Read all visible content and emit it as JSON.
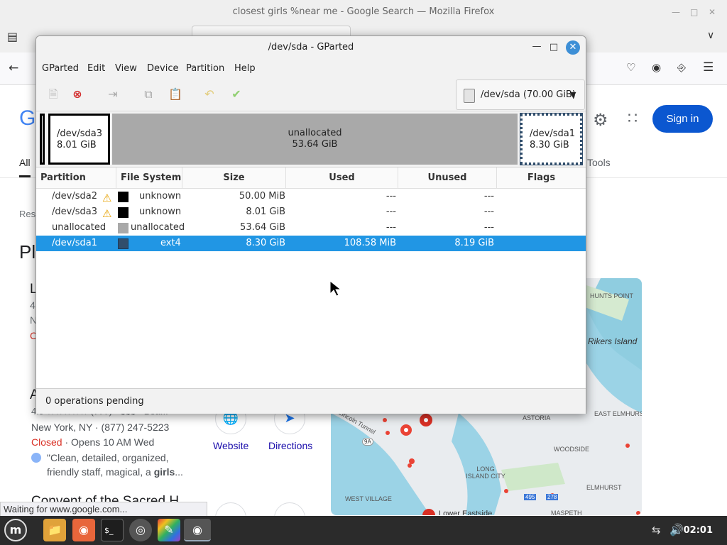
{
  "firefox": {
    "title": "closest girls %near me - Google Search — Mozilla Firefox",
    "status": "Waiting for www.google.com..."
  },
  "google": {
    "logo_fragment": "G",
    "tab_all": "All",
    "tools": "Tools",
    "results_fragment": "Res",
    "places_fragment": "Pl",
    "sign_in": "Sign in",
    "listing_fragments": {
      "l1": "L",
      "l2": "4",
      "l3": "N",
      "l4": "C",
      "l5": "A",
      "rating_fragment": "4.9 ★★★★★ (777) · $$$ · Bea..."
    },
    "listing": {
      "address": "New York, NY · (877) 247-5223",
      "closed": "Closed",
      "opens": " · Opens 10 AM Wed",
      "review_line1": "\"Clean, detailed, organized,",
      "review_line2_pre": "friendly staff, magical, a ",
      "review_line2_bold": "girls",
      "review_line2_post": "...",
      "website": "Website",
      "directions": "Directions",
      "next_title": "Convent of the Sacred H..."
    },
    "map_labels": [
      "HUNTS POINT",
      "Rikers Island",
      "EAST ELMHURST",
      "ASTORIA",
      "WOODSIDE",
      "LONG ISLAND CITY",
      "ELMHURST",
      "WEST VILLAGE",
      "MASPETH",
      "Lower Eastside",
      "Lincoln Tunnel",
      "9A",
      "495",
      "278"
    ]
  },
  "gparted": {
    "title": "/dev/sda - GParted",
    "menu": [
      "GParted",
      "Edit",
      "View",
      "Device",
      "Partition",
      "Help"
    ],
    "device": "/dev/sda (70.00 GiB)",
    "visual": [
      {
        "name": "/dev/sda3",
        "size": "8.01 GiB"
      },
      {
        "name": "unallocated",
        "size": "53.64 GiB"
      },
      {
        "name": "/dev/sda1",
        "size": "8.30 GiB"
      }
    ],
    "columns": [
      "Partition",
      "File System",
      "Size",
      "Used",
      "Unused",
      "Flags"
    ],
    "rows": [
      {
        "partition": "/dev/sda2",
        "fs": "unknown",
        "size": "50.00 MiB",
        "used": "---",
        "unused": "---",
        "warn": true
      },
      {
        "partition": "/dev/sda3",
        "fs": "unknown",
        "size": "8.01 GiB",
        "used": "---",
        "unused": "---",
        "warn": true
      },
      {
        "partition": "unallocated",
        "fs": "unallocated",
        "size": "53.64 GiB",
        "used": "---",
        "unused": "---",
        "warn": false
      },
      {
        "partition": "/dev/sda1",
        "fs": "ext4",
        "size": "8.30 GiB",
        "used": "108.58 MiB",
        "unused": "8.19 GiB",
        "warn": false
      }
    ],
    "status": "0 operations pending",
    "colors": {
      "selection": "#2196e4",
      "unknown_fs": "#000000",
      "unallocated_fs": "#a9a9a9",
      "ext4_fs": "#314e6c"
    }
  },
  "taskbar": {
    "clock": "02:01"
  }
}
